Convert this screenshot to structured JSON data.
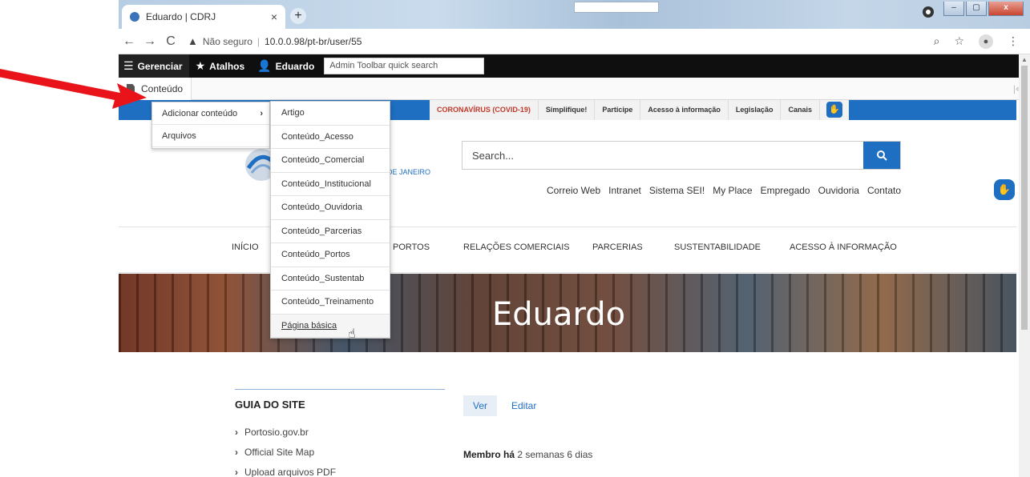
{
  "browser": {
    "tab_title": "Eduardo | CDRJ",
    "tab_close": "×",
    "new_tab": "+",
    "back": "←",
    "forward": "→",
    "reload": "C",
    "security_label": "Não seguro",
    "url": "10.0.0.98/pt-br/user/55",
    "window_minimize": "–",
    "window_maximize": "▢",
    "window_close": "x"
  },
  "admin_toolbar": {
    "manage": "Gerenciar",
    "shortcuts": "Atalhos",
    "user": "Eduardo",
    "search_placeholder": "Admin Toolbar quick search"
  },
  "tray": {
    "content": "Conteúdo"
  },
  "menu_level1": {
    "items": [
      {
        "label": "Adicionar conteúdo",
        "arrow": "›"
      },
      {
        "label": "Arquivos"
      }
    ]
  },
  "menu_level2": {
    "items": [
      "Artigo",
      "Conteúdo_Acesso",
      "Conteúdo_Comercial",
      "Conteúdo_Institucional",
      "Conteúdo_Ouvidoria",
      "Conteúdo_Parcerias",
      "Conteúdo_Portos",
      "Conteúdo_Sustentab",
      "Conteúdo_Treinamento",
      "Página básica"
    ]
  },
  "gov_bar": {
    "links": [
      "CORONAVÍRUS (COVID-19)",
      "Simplifique!",
      "Participe",
      "Acesso à informação",
      "Legislação",
      "Canais"
    ]
  },
  "site": {
    "logo_text": "DE JANEIRO",
    "search_placeholder": "Search...",
    "top_links": [
      "Correio Web",
      "Intranet",
      "Sistema SEI!",
      "My Place",
      "Empregado",
      "Ouvidoria",
      "Contato"
    ],
    "main_nav": {
      "inicio": "INÍCIO",
      "portos": "PORTOS",
      "relacoes": "RELAÇÕES COMERCIAIS",
      "parcerias": "PARCERIAS",
      "sustentabilidade": "SUSTENTABILIDADE",
      "acesso": "ACESSO À INFORMAÇÃO"
    },
    "hero_title": "Eduardo",
    "guia_title": "GUIA DO SITE",
    "guia_links": [
      "Portosio.gov.br",
      "Official Site Map",
      "Upload arquivos PDF"
    ],
    "tab_ver": "Ver",
    "tab_editar": "Editar",
    "member_label": "Membro há",
    "member_value": "2 semanas 6 dias"
  },
  "colors": {
    "accent_blue": "#1e6fc1",
    "arrow_red": "#e8141a",
    "toolbar_black": "#0f0f0f"
  }
}
